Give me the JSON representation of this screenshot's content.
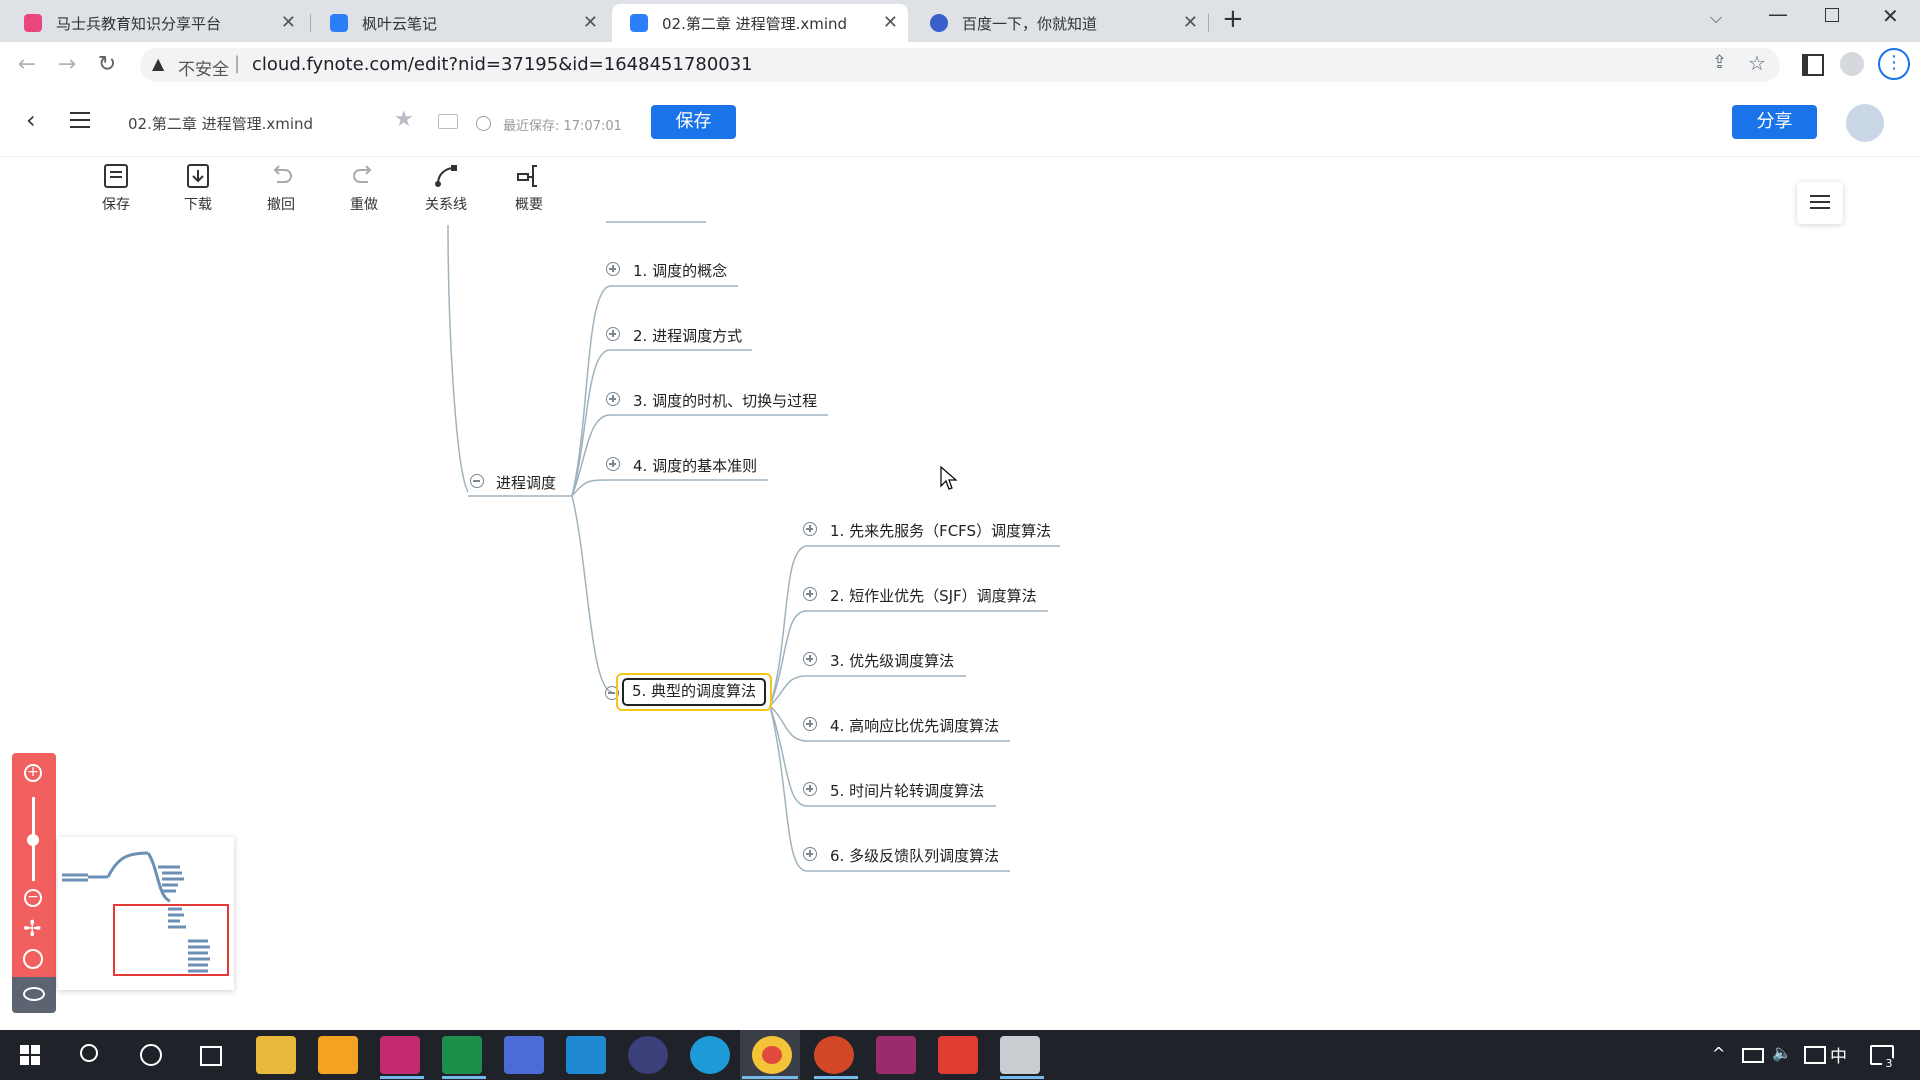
{
  "browser": {
    "tabs": [
      {
        "title": "马士兵教育知识分享平台"
      },
      {
        "title": "枫叶云笔记"
      },
      {
        "title": "02.第二章 进程管理.xmind"
      },
      {
        "title": "百度一下，你就知道"
      }
    ],
    "security_label": "不安全",
    "url": "cloud.fynote.com/edit?nid=37195&id=1648451780031"
  },
  "app": {
    "filename": "02.第二章 进程管理.xmind",
    "last_saved": "最近保存: 17:07:01",
    "save_button": "保存",
    "share_button": "分享"
  },
  "toolbar": [
    {
      "label": "保存",
      "icon": "save-icon"
    },
    {
      "label": "下载",
      "icon": "download-icon"
    },
    {
      "label": "撤回",
      "icon": "undo-icon"
    },
    {
      "label": "重做",
      "icon": "redo-icon"
    },
    {
      "label": "关系线",
      "icon": "relation-line-icon"
    },
    {
      "label": "概要",
      "icon": "summary-icon"
    }
  ],
  "mindmap": {
    "parent": "进程调度",
    "children": [
      "1. 调度的概念",
      "2. 进程调度方式",
      "3. 调度的时机、切换与过程",
      "4. 调度的基本准则",
      "5. 典型的调度算法"
    ],
    "selected": "5. 典型的调度算法",
    "algorithms": [
      "1. 先来先服务（FCFS）调度算法",
      "2. 短作业优先（SJF）调度算法",
      "3. 优先级调度算法",
      "4. 高响应比优先调度算法",
      "5. 时间片轮转调度算法",
      "6. 多级反馈队列调度算法"
    ]
  },
  "zoom_controls": [
    "zoom-in-icon",
    "zoom-out-icon",
    "move-icon",
    "center-icon",
    "eye-icon"
  ],
  "colors": {
    "accent": "#1a73e8",
    "zoom_panel": "#f25f5f",
    "selected_border": "#f5c518",
    "taskbar": "#1f2329"
  },
  "taskbar": {
    "apps": [
      "start-icon",
      "search-icon",
      "cortana-icon",
      "task-view-icon",
      "file-explorer-icon",
      "app-icon",
      "intellij-icon",
      "pycharm-icon",
      "goland-icon",
      "vscode-icon",
      "eclipse-icon",
      "edge-icon",
      "chrome-icon",
      "powerpoint-icon",
      "pdf-icon",
      "xmind-icon",
      "mail-icon"
    ],
    "ime": "中",
    "notification_count": "3"
  }
}
